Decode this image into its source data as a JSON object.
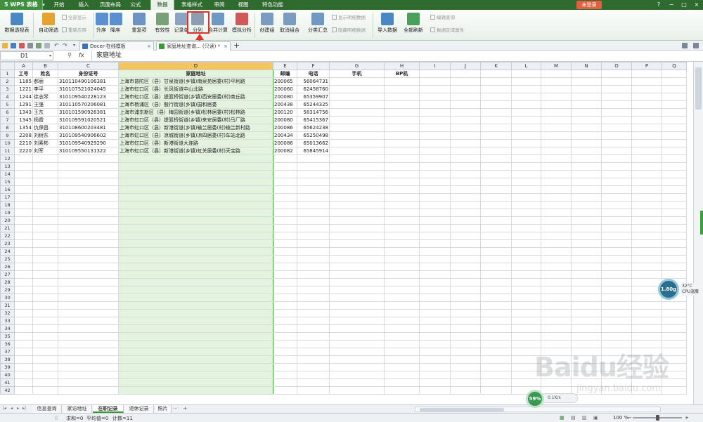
{
  "app": {
    "logo": "5 WPS 表格",
    "menu_tabs": [
      "开始",
      "插入",
      "页面布局",
      "公式",
      "数据",
      "表格样式",
      "审阅",
      "视图",
      "特色功能"
    ],
    "active_tab": "数据",
    "login_label": "未登录",
    "window_controls": [
      "?",
      "−",
      "□",
      "×"
    ]
  },
  "ribbon": {
    "buttons": [
      {
        "label": "数据透视表",
        "color": "#4a87c5"
      },
      {
        "label": "自动筛选",
        "color": "#e6a22e"
      },
      {
        "label": "升序",
        "color": "#5a8fd0"
      },
      {
        "label": "降序",
        "color": "#5a8fd0"
      },
      {
        "label": "重复项",
        "color": "#6b93c4"
      },
      {
        "label": "有效性",
        "color": "#7aa07a"
      },
      {
        "label": "记录单",
        "color": "#8aa5c4"
      },
      {
        "label": "分列",
        "color": "#8c9db0"
      },
      {
        "label": "合并计算",
        "color": "#6f99c2"
      },
      {
        "label": "模拟分析",
        "color": "#d05a5a"
      },
      {
        "label": "创建组",
        "color": "#7a9cc0"
      },
      {
        "label": "取消组合",
        "color": "#7a9cc0"
      },
      {
        "label": "分类汇总",
        "color": "#6f99c2"
      },
      {
        "label": "导入数据",
        "color": "#4a87c5"
      },
      {
        "label": "全部刷新",
        "color": "#4aa05a"
      }
    ],
    "small_items": [
      "全部显示",
      "重新应用",
      "显示明细数据",
      "隐藏明细数据",
      "编辑查询",
      "数据区域属性"
    ]
  },
  "doc_tabs": [
    {
      "label": "Docer-在线模板",
      "color": "#3f6fb5"
    },
    {
      "label": "家庭地址查询... (只读) *",
      "color": "#3a9a3a"
    }
  ],
  "new_tab_label": "+",
  "formula": {
    "name_box": "D1",
    "fx": "fx",
    "content": "家庭地址"
  },
  "columns": [
    "A",
    "B",
    "C",
    "D",
    "E",
    "F",
    "G",
    "H",
    "I",
    "J",
    "K",
    "L",
    "M",
    "N",
    "O",
    "P",
    "Q"
  ],
  "selected_column": "D",
  "header_row": [
    "工号",
    "姓名",
    "身份证号",
    "家庭地址",
    "邮编",
    "电话",
    "手机",
    "BP机"
  ],
  "rows": [
    [
      "1185",
      "郝丽",
      "310110490106381",
      "上海市普陀区（县）甘泉街道(乡镇)南泉苑居委(村)平利路",
      "200065",
      "56064731"
    ],
    [
      "1221",
      "李平",
      "310107521024045",
      "上海市虹口区（县）长风街道中山北路",
      "200060",
      "62458760"
    ],
    [
      "1244",
      "徐志琴",
      "310109540228123",
      "上海市虹口区（县）提篮桥街道(乡镇)西安居委(村)商丘路",
      "200080",
      "65359907"
    ],
    [
      "1291",
      "王强",
      "310110570206081",
      "上海市杨浦区（县）殷行街道(乡镇)国和居委",
      "200438",
      "65244325"
    ],
    [
      "1343",
      "王东",
      "310101590926381",
      "上海市浦东新区（县）梅园街道(乡镇)松林居委(村)松林路",
      "200120",
      "58314756"
    ],
    [
      "1345",
      "杨霞",
      "310109591020521",
      "上海市虹口区（县）提篮桥街道(乡镇)来安居委(村)马厂路",
      "200080",
      "65415367"
    ],
    [
      "1354",
      "仇保昌",
      "310108600203481",
      "上海市虹口区（县）新港街道(乡镇)输兰居委(村)输兰新村路",
      "200086",
      "65624238"
    ],
    [
      "2208",
      "刘树东",
      "310109540906602",
      "上海市虹口区（县）凉城街道(乡镇)凉四居委(村)车站北路",
      "200434",
      "65250498"
    ],
    [
      "2210",
      "刘素彬",
      "310109540929290",
      "上海市虹口区（县）新港街道大连路",
      "200086",
      "65013662"
    ],
    [
      "2220",
      "刘军",
      "310109550131322",
      "上海市虹口区（县）新港街道(乡镇)虹关居委(村)天宝路",
      "200082",
      "65845914"
    ]
  ],
  "row_count": 42,
  "sheet_tabs": [
    "信息查询",
    "家访地址",
    "在职记录",
    "退休记录",
    "照片"
  ],
  "active_sheet": "在职记录",
  "sheet_more": "···",
  "sheet_add": "+",
  "status": {
    "sum": "求和=0",
    "avg": "平均值=0",
    "count": "计数=11",
    "zoom": "100 %"
  },
  "cpu_widget": {
    "value": "1.80g",
    "temp": "32°C",
    "label": "CPU温度"
  },
  "speed_widget": {
    "percent": "59%",
    "text": "0.1K/s"
  },
  "watermark": {
    "brand": "Baidu经验",
    "url": "jingyan.baidu.com"
  }
}
